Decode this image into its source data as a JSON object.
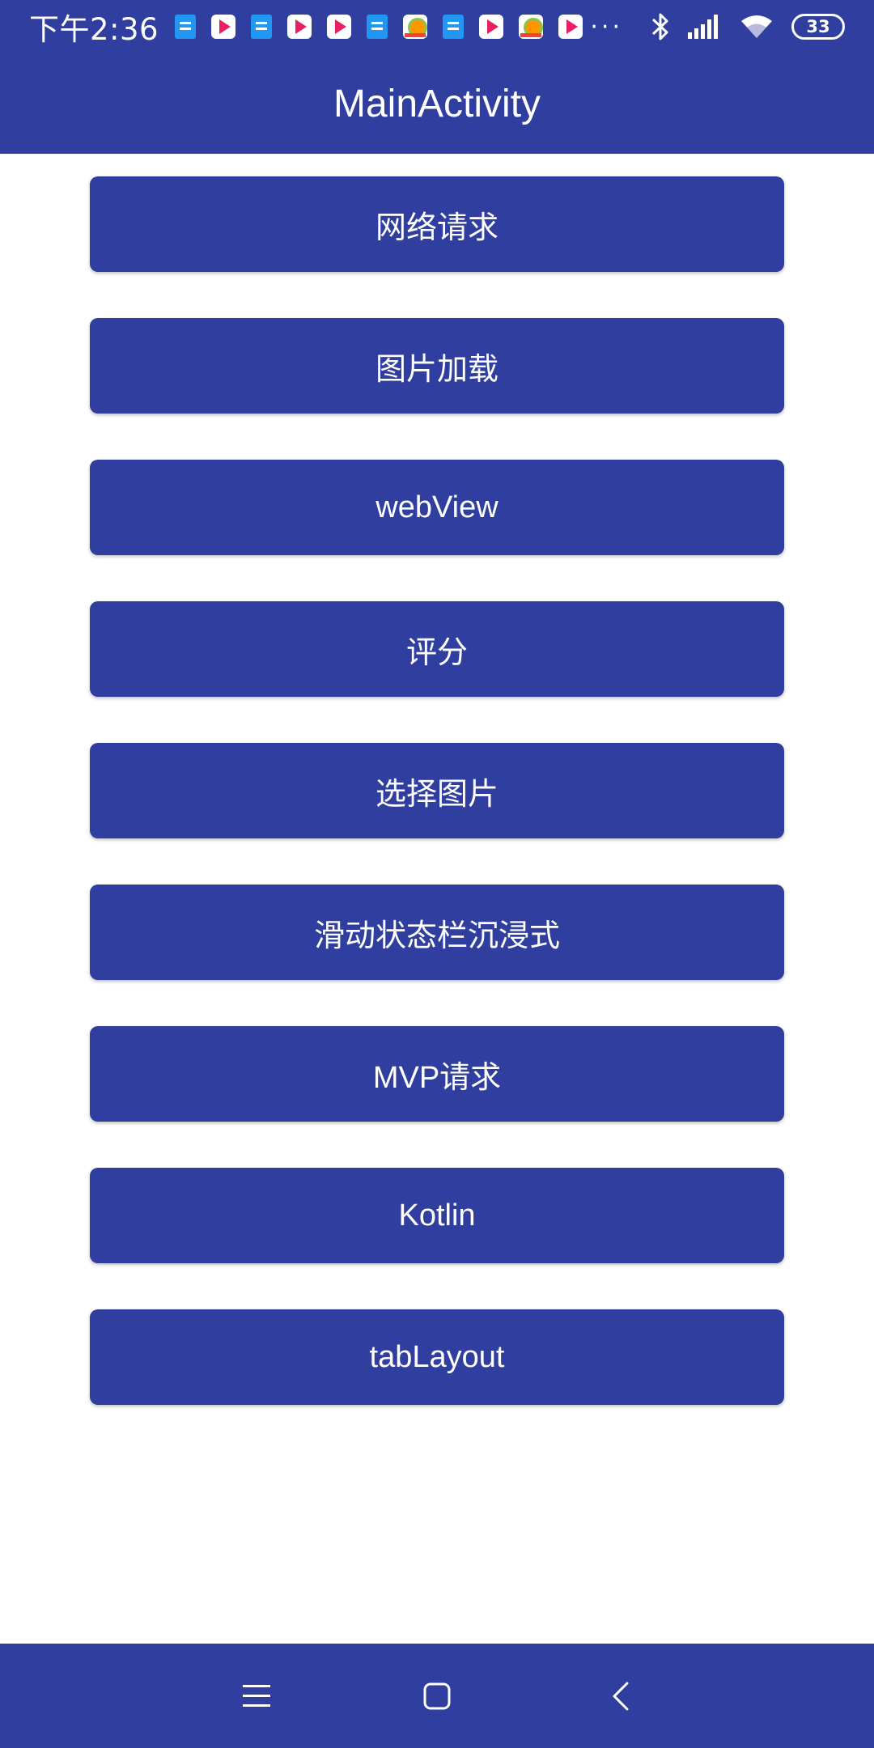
{
  "status_bar": {
    "time": "下午2:36",
    "notification_icons": [
      "doc-icon",
      "play-icon",
      "doc-icon",
      "play-icon",
      "play-icon",
      "doc-icon",
      "picture-icon",
      "doc-icon",
      "play-icon",
      "picture-icon",
      "play-icon"
    ],
    "more": "···",
    "battery": "33"
  },
  "toolbar": {
    "title": "MainActivity"
  },
  "buttons": [
    {
      "label": "网络请求"
    },
    {
      "label": "图片加载"
    },
    {
      "label": "webView"
    },
    {
      "label": "评分"
    },
    {
      "label": "选择图片"
    },
    {
      "label": "滑动状态栏沉浸式"
    },
    {
      "label": "MVP请求"
    },
    {
      "label": "Kotlin"
    },
    {
      "label": "tabLayout"
    }
  ],
  "colors": {
    "primary": "#303f9f",
    "background": "#ffffff",
    "text_on_primary": "#ffffff"
  }
}
